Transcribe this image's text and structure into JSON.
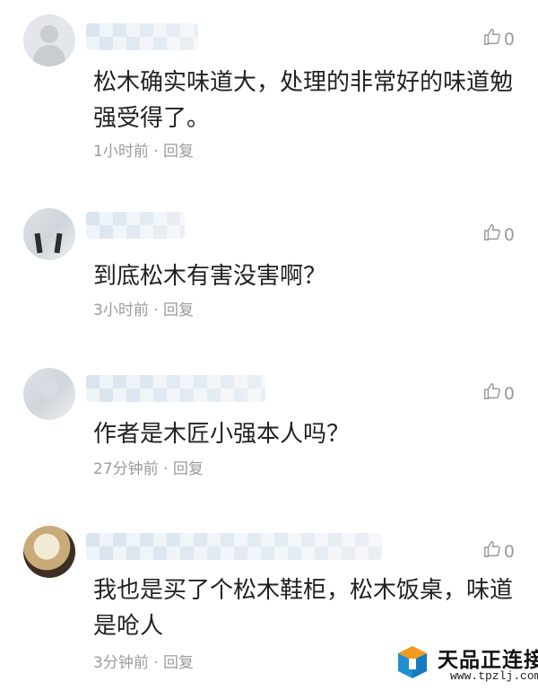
{
  "comments": [
    {
      "text": "松木确实味道大，处理的非常好的味道勉强受得了。",
      "time": "1小时前",
      "reply": "回复",
      "likes": "0",
      "avatar_icon": "default-user-icon"
    },
    {
      "text": "到底松木有害没害啊？",
      "time": "3小时前",
      "reply": "回复",
      "likes": "0",
      "avatar_icon": "user-photo-icon"
    },
    {
      "text": "作者是木匠小强本人吗？",
      "time": "27分钟前",
      "reply": "回复",
      "likes": "0",
      "avatar_icon": "user-photo-icon"
    },
    {
      "text": "我也是买了个松木鞋柜，松木饭桌，味道是呛人",
      "time": "3分钟前",
      "reply": "回复",
      "likes": "0",
      "avatar_icon": "user-photo-icon"
    }
  ],
  "separator": "·",
  "watermark": {
    "name": "天品正连接",
    "url": "www.tpzlj.com"
  },
  "colors": {
    "text": "#222222",
    "meta": "#9b9b9b",
    "like": "#9a9a9a",
    "logo_orange": "#f29a1d",
    "logo_blue": "#1f8fd6"
  }
}
